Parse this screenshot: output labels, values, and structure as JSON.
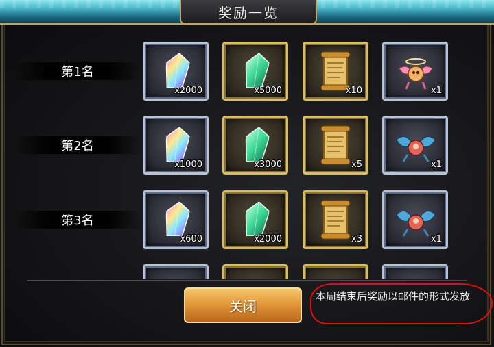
{
  "title": "奖励一览",
  "ranks": [
    {
      "label": "第1名",
      "rewards": [
        {
          "item": "rainbow-crystal-icon",
          "qty": "x2000",
          "frame": "silver"
        },
        {
          "item": "green-crystal-icon",
          "qty": "x5000",
          "frame": "gold"
        },
        {
          "item": "scroll-icon",
          "qty": "x10",
          "frame": "gold"
        },
        {
          "item": "winged-orb-pet-icon",
          "qty": "x1",
          "frame": "silver"
        }
      ]
    },
    {
      "label": "第2名",
      "rewards": [
        {
          "item": "rainbow-crystal-icon",
          "qty": "x1000",
          "frame": "silver"
        },
        {
          "item": "green-crystal-icon",
          "qty": "x3000",
          "frame": "gold"
        },
        {
          "item": "scroll-icon",
          "qty": "x5",
          "frame": "gold"
        },
        {
          "item": "winged-orb-pet-icon",
          "qty": "x1",
          "frame": "silver"
        }
      ]
    },
    {
      "label": "第3名",
      "rewards": [
        {
          "item": "rainbow-crystal-icon",
          "qty": "x600",
          "frame": "silver"
        },
        {
          "item": "green-crystal-icon",
          "qty": "x2000",
          "frame": "gold"
        },
        {
          "item": "scroll-icon",
          "qty": "x3",
          "frame": "gold"
        },
        {
          "item": "winged-orb-pet-icon",
          "qty": "x1",
          "frame": "silver"
        }
      ]
    }
  ],
  "close_label": "关闭",
  "note": "本周结束后奖励以邮件的形式发放",
  "colors": {
    "close_button": "#e09536",
    "highlight_ring": "#e01010",
    "title_bar": "#4bb6c8"
  }
}
